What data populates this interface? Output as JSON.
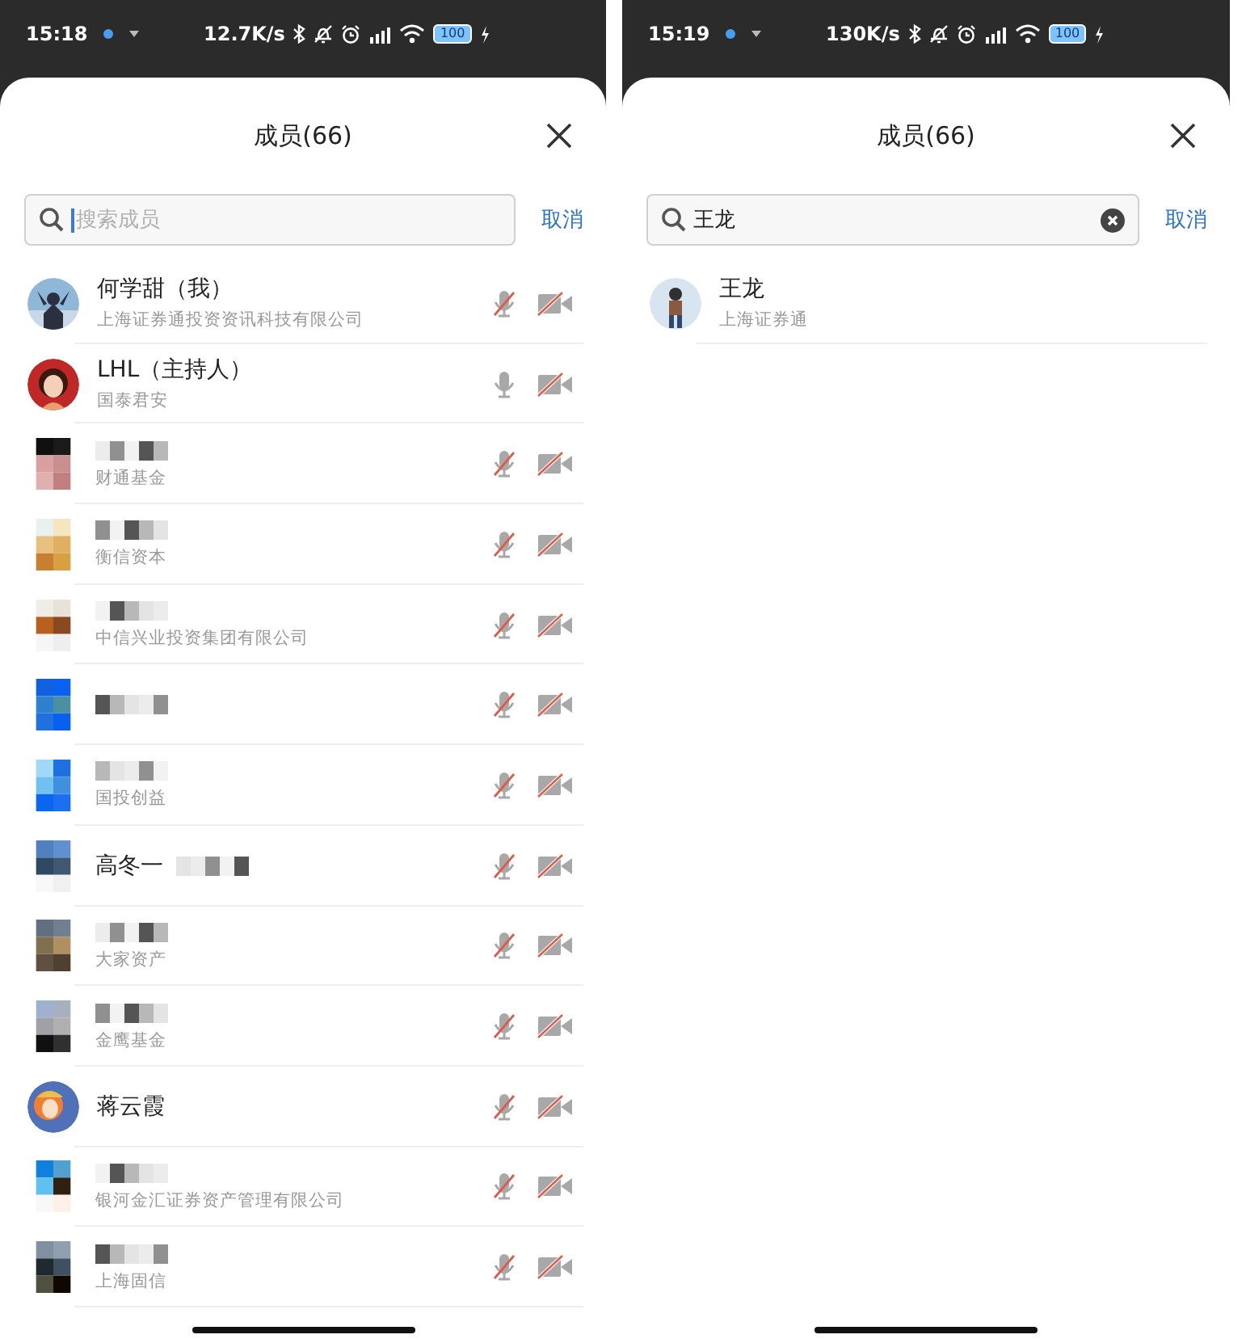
{
  "phones": [
    {
      "status_bar": {
        "time": "15:18",
        "speed": "12.7K/s",
        "battery": "100"
      },
      "sheet": {
        "title": "成员(66)",
        "search": {
          "placeholder": "搜索成员"
        },
        "cancel": "取消"
      },
      "members": [
        {
          "name": "何学甜（我）",
          "org": "上海证券通投资资讯科技有限公司",
          "redacted": false,
          "mic_muted": true,
          "camera_off": true
        },
        {
          "name": "LHL（主持人）",
          "org": "国泰君安",
          "redacted": false,
          "mic_muted": false,
          "camera_off": true
        },
        {
          "org": "财通基金",
          "redacted": true,
          "mic_muted": true,
          "camera_off": true
        },
        {
          "org": "衡信资本",
          "redacted": true,
          "mic_muted": true,
          "camera_off": true
        },
        {
          "org": "中信兴业投资集团有限公司",
          "redacted": true,
          "mic_muted": true,
          "camera_off": true
        },
        {
          "redacted": true,
          "mic_muted": true,
          "camera_off": true
        },
        {
          "org": "国投创益",
          "redacted": true,
          "mic_muted": true,
          "camera_off": true
        },
        {
          "name": "高冬一",
          "redacted": true,
          "mic_muted": true,
          "camera_off": true
        },
        {
          "org": "大家资产",
          "redacted": true,
          "mic_muted": true,
          "camera_off": true
        },
        {
          "org": "金鹰基金",
          "redacted": true,
          "mic_muted": true,
          "camera_off": true
        },
        {
          "name": "蒋云霞",
          "redacted": false,
          "mic_muted": true,
          "camera_off": true
        },
        {
          "org": "银河金汇证券资产管理有限公司",
          "redacted": true,
          "mic_muted": true,
          "camera_off": true
        },
        {
          "org": "上海固信",
          "redacted": true,
          "mic_muted": true,
          "camera_off": true
        }
      ]
    },
    {
      "status_bar": {
        "time": "15:19",
        "speed": "130K/s",
        "battery": "100"
      },
      "sheet": {
        "title": "成员(66)",
        "search": {
          "value": "王龙"
        },
        "cancel": "取消"
      },
      "members": [
        {
          "name": "王龙",
          "org": "上海证券通",
          "redacted": false
        }
      ]
    }
  ]
}
